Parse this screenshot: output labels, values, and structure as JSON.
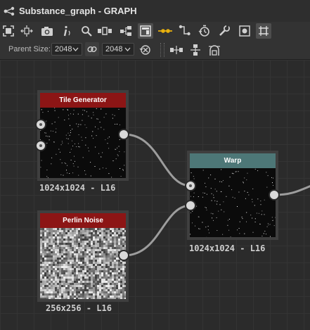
{
  "window": {
    "title": "Substance_graph - GRAPH",
    "title_icon": "graph-share-icon"
  },
  "toolbar": {
    "row1_icons": [
      "frame-selection-icon",
      "dependency-layout-icon",
      "snapshot-camera-icon",
      "info-icon",
      "search-icon",
      "align-nodes-icon",
      "hierarchy-icon",
      "display-panel-icon",
      "link-style-icon",
      "connect-icon",
      "timer-icon",
      "tools-icon",
      "preview-icon",
      "grid-snap-icon"
    ],
    "parent_size_label": "Parent Size:",
    "parent_size_width": "2048",
    "parent_size_height": "2048",
    "row2_icons": [
      "link-ratio-icon",
      "reset-size-icon",
      "align-horizontal-icon",
      "align-vertical-icon",
      "distribute-icon"
    ]
  },
  "nodes": [
    {
      "title": "Tile Generator",
      "label": "1024x1024 - L16",
      "header_color": "#8c1515"
    },
    {
      "title": "Perlin Noise",
      "label": "256x256 - L16",
      "header_color": "#8c1515"
    },
    {
      "title": "Warp",
      "label": "1024x1024 - L16",
      "header_color": "#4d7777"
    }
  ],
  "colors": {
    "background": "#2b2b2b",
    "accent_yellow": "#e8b10e",
    "generator_header": "#8c1515",
    "filter_header": "#4d7777"
  }
}
